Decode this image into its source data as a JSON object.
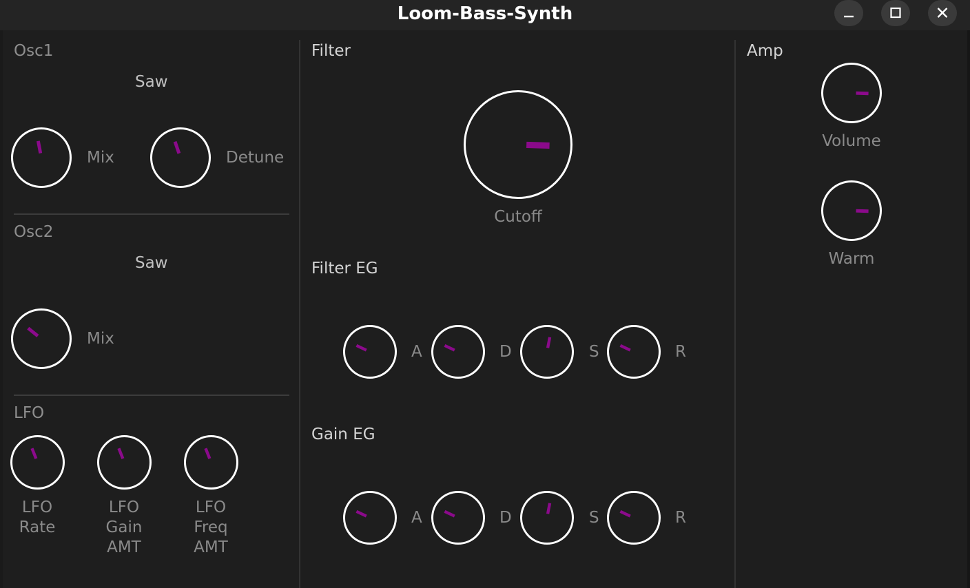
{
  "window": {
    "title": "Loom-Bass-Synth",
    "buttons": [
      {
        "name": "minimize-button",
        "icon": "minimize-icon"
      },
      {
        "name": "maximize-button",
        "icon": "maximize-icon"
      },
      {
        "name": "close-button",
        "icon": "close-icon"
      }
    ]
  },
  "colors": {
    "background": "#1e1e1e",
    "titlebar": "#242424",
    "knob_ring": "#ffffff",
    "knob_indicator": "#8b0a8b",
    "label": "#8a8a8a"
  },
  "osc1": {
    "title": "Osc1",
    "waveform": "Saw",
    "knobs": {
      "mix": {
        "label": "Mix",
        "value": 0.46
      },
      "detune": {
        "label": "Detune",
        "value": 0.43
      }
    }
  },
  "osc2": {
    "title": "Osc2",
    "waveform": "Saw",
    "knobs": {
      "mix": {
        "label": "Mix",
        "value": 0.31
      }
    }
  },
  "lfo": {
    "title": "LFO",
    "knobs": {
      "rate": {
        "label": [
          "LFO",
          "Rate"
        ],
        "value": 0.42
      },
      "gain_amt": {
        "label": [
          "LFO",
          "Gain",
          "AMT"
        ],
        "value": 0.42
      },
      "freq_amt": {
        "label": [
          "LFO",
          "Freq",
          "AMT"
        ],
        "value": 0.42
      }
    }
  },
  "filter": {
    "title": "Filter",
    "cutoff": {
      "label": "Cutoff",
      "value": 0.84
    }
  },
  "filter_eg": {
    "title": "Filter EG",
    "knobs": {
      "a": {
        "label": "A",
        "value": 0.26
      },
      "d": {
        "label": "D",
        "value": 0.26
      },
      "s": {
        "label": "S",
        "value": 0.54
      },
      "r": {
        "label": "R",
        "value": 0.26
      }
    }
  },
  "gain_eg": {
    "title": "Gain EG",
    "knobs": {
      "a": {
        "label": "A",
        "value": 0.26
      },
      "d": {
        "label": "D",
        "value": 0.26
      },
      "s": {
        "label": "S",
        "value": 0.54
      },
      "r": {
        "label": "R",
        "value": 0.26
      }
    }
  },
  "amp": {
    "title": "Amp",
    "knobs": {
      "volume": {
        "label": "Volume",
        "value": 0.84
      },
      "warm": {
        "label": "Warm",
        "value": 0.84
      }
    }
  }
}
